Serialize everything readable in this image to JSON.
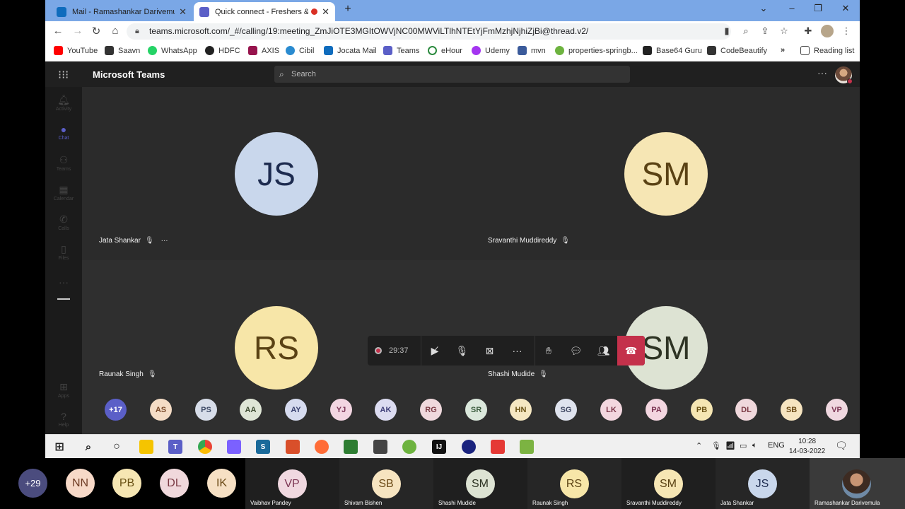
{
  "browser": {
    "tabs": [
      {
        "title": "Mail - Ramashankar Darivemula"
      },
      {
        "title": "Quick connect - Freshers &"
      }
    ],
    "url": "teams.microsoft.com/_#/calling/19:meeting_ZmJiOTE3MGItOWVjNC00MWViLTlhNTEtYjFmMzhjNjhiZjBi@thread.v2/",
    "bookmarks": [
      "YouTube",
      "Saavn",
      "WhatsApp",
      "HDFC",
      "AXIS",
      "Cibil",
      "Jocata Mail",
      "Teams",
      "eHour",
      "Udemy",
      "mvn",
      "properties-springb...",
      "Base64 Guru",
      "CodeBeautify"
    ],
    "reading_list": "Reading list"
  },
  "teams": {
    "app_name": "Microsoft Teams",
    "search_placeholder": "Search",
    "rail": [
      "Activity",
      "Chat",
      "Teams",
      "Calendar",
      "Calls",
      "Files",
      "Apps",
      "Help"
    ]
  },
  "stage": {
    "tiles": [
      {
        "initials": "JS",
        "name": "Jata Shankar",
        "bg": "#c9d7ec",
        "fg": "#1d2b4f"
      },
      {
        "initials": "SM",
        "name": "Sravanthi Muddireddy",
        "bg": "#f6e6b4",
        "fg": "#5a4214"
      },
      {
        "initials": "RS",
        "name": "Raunak Singh",
        "bg": "#f7e6a8",
        "fg": "#5a4214"
      },
      {
        "initials": "SM",
        "name": "Shashi Mudide",
        "bg": "#dde3d3",
        "fg": "#2e3424"
      }
    ],
    "call_timer": "29:37",
    "overflow_count": "+17",
    "small_participants": [
      {
        "initials": "AS",
        "bg": "#f4dcc5",
        "fg": "#7a4a2a"
      },
      {
        "initials": "PS",
        "bg": "#d7dde9",
        "fg": "#3d4a66"
      },
      {
        "initials": "AA",
        "bg": "#dfe6d6",
        "fg": "#3f4d33"
      },
      {
        "initials": "AY",
        "bg": "#d6dbef",
        "fg": "#3a4270"
      },
      {
        "initials": "YJ",
        "bg": "#f3d6e2",
        "fg": "#7b3456"
      },
      {
        "initials": "AK",
        "bg": "#dcdcf1",
        "fg": "#40407a"
      },
      {
        "initials": "RG",
        "bg": "#f0d9dd",
        "fg": "#7b3a44"
      },
      {
        "initials": "SR",
        "bg": "#dbe8dc",
        "fg": "#3b5c3e"
      },
      {
        "initials": "HN",
        "bg": "#f5e7c2",
        "fg": "#6b5316"
      },
      {
        "initials": "SG",
        "bg": "#dfe3ee",
        "fg": "#3e4661"
      },
      {
        "initials": "LK",
        "bg": "#f3d7df",
        "fg": "#7b3448"
      },
      {
        "initials": "PA",
        "bg": "#f3d6e0",
        "fg": "#7b3452"
      },
      {
        "initials": "PB",
        "bg": "#f5e6b3",
        "fg": "#6b5316"
      },
      {
        "initials": "DL",
        "bg": "#f0d8dc",
        "fg": "#7b3a44"
      },
      {
        "initials": "SB",
        "bg": "#f6e4c0",
        "fg": "#6b4a16"
      },
      {
        "initials": "VP",
        "bg": "#f0d8e0",
        "fg": "#7b3452"
      }
    ]
  },
  "taskbar": {
    "lang": "ENG",
    "time": "10:28",
    "date": "14-03-2022"
  },
  "outer_gallery": {
    "overflow_count": "+29",
    "bubbles": [
      {
        "initials": "NN",
        "bg": "#f7d9c8",
        "fg": "#6e3b24"
      },
      {
        "initials": "PB",
        "bg": "#f6e6b3",
        "fg": "#6b5316"
      },
      {
        "initials": "DL",
        "bg": "#f0d8dc",
        "fg": "#7b3a44"
      },
      {
        "initials": "IK",
        "bg": "#f6e0c4",
        "fg": "#6b4a16"
      }
    ],
    "tiles": [
      {
        "initials": "VP",
        "name": "Vaibhav Pandey",
        "bg": "#f0d8e0",
        "fg": "#7b3452"
      },
      {
        "initials": "SB",
        "name": "Shivam Bishen",
        "bg": "#f6e4c0",
        "fg": "#6b4a16"
      },
      {
        "initials": "SM",
        "name": "Shashi Mudide",
        "bg": "#dde3d3",
        "fg": "#2e3424"
      },
      {
        "initials": "RS",
        "name": "Raunak Singh",
        "bg": "#f7e6a8",
        "fg": "#5a4214"
      },
      {
        "initials": "SM",
        "name": "Sravanthi Muddireddy",
        "bg": "#f6e6b4",
        "fg": "#5a4214"
      },
      {
        "initials": "JS",
        "name": "Jata Shankar",
        "bg": "#c9d7ec",
        "fg": "#1d2b4f"
      },
      {
        "initials": "",
        "name": "Ramashankar Darivemula",
        "bg": "",
        "fg": ""
      }
    ]
  }
}
